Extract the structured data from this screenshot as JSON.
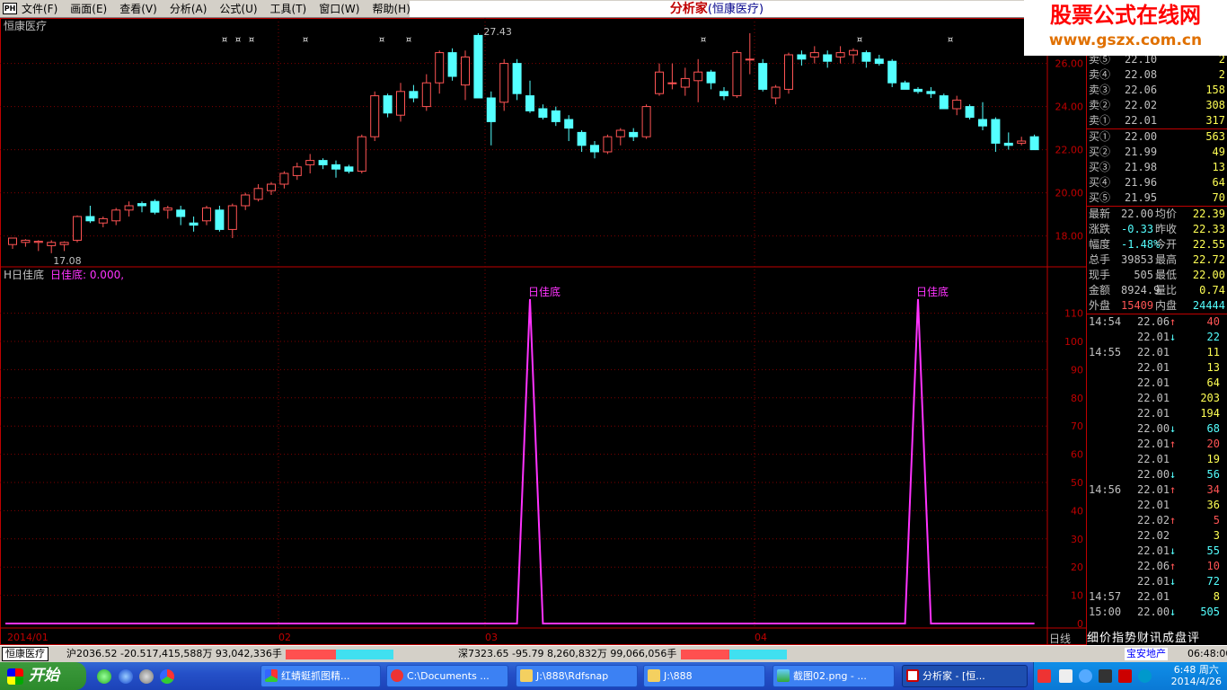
{
  "menubar": {
    "items": [
      "文件(F)",
      "画面(E)",
      "查看(V)",
      "分析(A)",
      "公式(U)",
      "工具(T)",
      "窗口(W)",
      "帮助(H)"
    ],
    "app_title": "分析家",
    "stock_title": "(恒康医疗)"
  },
  "watermark": {
    "line1": "股票公式在线网",
    "line2": "www.gszx.com.cn"
  },
  "main_chart": {
    "stock_name": "恒康医疗",
    "high_label": "27.43",
    "low_label": "17.08",
    "ylabels": [
      "26.00",
      "24.00",
      "22.00",
      "20.00",
      "18.00"
    ],
    "marker_glyph": "¤"
  },
  "indicator": {
    "name": "H日佳底",
    "value_text": "日佳底: 0.000,",
    "signal_label": "日佳底",
    "ylabels": [
      "110",
      "100",
      "90",
      "80",
      "70",
      "60",
      "50",
      "40",
      "30",
      "20",
      "10",
      "0"
    ]
  },
  "xaxis": {
    "labels": [
      "2014/01",
      "02",
      "03",
      "04"
    ],
    "right_label": "日线"
  },
  "order_book": {
    "sell": [
      {
        "label": "卖⑤",
        "price": "22.10",
        "vol": "2"
      },
      {
        "label": "卖④",
        "price": "22.08",
        "vol": "2"
      },
      {
        "label": "卖③",
        "price": "22.06",
        "vol": "158"
      },
      {
        "label": "卖②",
        "price": "22.02",
        "vol": "308"
      },
      {
        "label": "卖①",
        "price": "22.01",
        "vol": "317"
      }
    ],
    "buy": [
      {
        "label": "买①",
        "price": "22.00",
        "vol": "563"
      },
      {
        "label": "买②",
        "price": "21.99",
        "vol": "49"
      },
      {
        "label": "买③",
        "price": "21.98",
        "vol": "13"
      },
      {
        "label": "买④",
        "price": "21.96",
        "vol": "64"
      },
      {
        "label": "买⑤",
        "price": "21.95",
        "vol": "70"
      }
    ]
  },
  "stats": [
    {
      "l1": "最新",
      "v1": "22.00",
      "l2": "均价",
      "v2": "22.39"
    },
    {
      "l1": "涨跌",
      "v1": "-0.33",
      "l2": "昨收",
      "v2": "22.33"
    },
    {
      "l1": "幅度",
      "v1": "-1.48%",
      "l2": "今开",
      "v2": "22.55"
    },
    {
      "l1": "总手",
      "v1": "39853",
      "l2": "最高",
      "v2": "22.72"
    },
    {
      "l1": "现手",
      "v1": "505",
      "l2": "最低",
      "v2": "22.00"
    },
    {
      "l1": "金额",
      "v1": "8924.9",
      "l2": "量比",
      "v2": "0.74"
    },
    {
      "l1": "外盘",
      "v1": "15409",
      "l2": "内盘",
      "v2": "24444"
    }
  ],
  "ticks": [
    {
      "time": "14:54",
      "price": "22.06",
      "dir": "up",
      "vol": "40"
    },
    {
      "time": "",
      "price": "22.01",
      "dir": "down",
      "vol": "22"
    },
    {
      "time": "14:55",
      "price": "22.01",
      "dir": "",
      "vol": "11"
    },
    {
      "time": "",
      "price": "22.01",
      "dir": "",
      "vol": "13"
    },
    {
      "time": "",
      "price": "22.01",
      "dir": "",
      "vol": "64"
    },
    {
      "time": "",
      "price": "22.01",
      "dir": "",
      "vol": "203"
    },
    {
      "time": "",
      "price": "22.01",
      "dir": "",
      "vol": "194"
    },
    {
      "time": "",
      "price": "22.00",
      "dir": "down",
      "vol": "68"
    },
    {
      "time": "",
      "price": "22.01",
      "dir": "up",
      "vol": "20"
    },
    {
      "time": "",
      "price": "22.01",
      "dir": "",
      "vol": "19"
    },
    {
      "time": "",
      "price": "22.00",
      "dir": "down",
      "vol": "56"
    },
    {
      "time": "14:56",
      "price": "22.01",
      "dir": "up",
      "vol": "34"
    },
    {
      "time": "",
      "price": "22.01",
      "dir": "",
      "vol": "36"
    },
    {
      "time": "",
      "price": "22.02",
      "dir": "up",
      "vol": "5"
    },
    {
      "time": "",
      "price": "22.02",
      "dir": "",
      "vol": "3"
    },
    {
      "time": "",
      "price": "22.01",
      "dir": "down",
      "vol": "55"
    },
    {
      "time": "",
      "price": "22.06",
      "dir": "up",
      "vol": "10"
    },
    {
      "time": "",
      "price": "22.01",
      "dir": "down",
      "vol": "72"
    },
    {
      "time": "14:57",
      "price": "22.01",
      "dir": "",
      "vol": "8"
    },
    {
      "time": "15:00",
      "price": "22.00",
      "dir": "down",
      "vol": "505"
    }
  ],
  "bottom_tabs": "细价指势财讯成盘评",
  "statusbar": {
    "tab": "恒康医疗",
    "sh": "沪2036.52 -20.517,415,588万 93,042,336手",
    "sz": "深7323.65 -95.79 8,260,832万 99,066,056手",
    "stock_ticker": "宝安地产",
    "time": "06:48:00"
  },
  "taskbar": {
    "start": "开始",
    "tasks": [
      "红蜻蜓抓图精...",
      "C:\\Documents ...",
      "J:\\888\\Rdfsnap",
      "J:\\888",
      "截图02.png - ...",
      "分析家 - [恒..."
    ],
    "clock_time": "6:48 周六",
    "clock_date": "2014/4/26"
  },
  "chart_data": {
    "type": "candlestick",
    "ohlc": [
      [
        17.6,
        17.9,
        17.4,
        17.9
      ],
      [
        17.7,
        17.85,
        17.5,
        17.8
      ],
      [
        17.7,
        17.8,
        17.3,
        17.75
      ],
      [
        17.55,
        17.8,
        17.2,
        17.7
      ],
      [
        17.6,
        17.75,
        17.3,
        17.7
      ],
      [
        17.8,
        18.95,
        17.7,
        18.9
      ],
      [
        18.9,
        19.4,
        18.6,
        18.7
      ],
      [
        18.6,
        18.9,
        18.4,
        18.8
      ],
      [
        18.7,
        19.3,
        18.5,
        19.2
      ],
      [
        19.2,
        19.6,
        18.9,
        19.4
      ],
      [
        19.5,
        19.6,
        19.1,
        19.4
      ],
      [
        19.6,
        19.7,
        19.0,
        19.1
      ],
      [
        19.2,
        19.4,
        18.8,
        19.3
      ],
      [
        19.2,
        19.4,
        18.5,
        18.9
      ],
      [
        18.6,
        18.9,
        18.2,
        18.5
      ],
      [
        18.7,
        19.4,
        18.5,
        19.3
      ],
      [
        19.2,
        19.4,
        18.2,
        18.3
      ],
      [
        18.3,
        19.5,
        17.9,
        19.4
      ],
      [
        19.4,
        20.0,
        19.2,
        19.9
      ],
      [
        19.7,
        20.4,
        19.6,
        20.2
      ],
      [
        20.1,
        20.5,
        19.9,
        20.4
      ],
      [
        20.4,
        21.0,
        20.2,
        20.9
      ],
      [
        20.8,
        21.4,
        20.6,
        21.2
      ],
      [
        21.3,
        21.8,
        20.9,
        21.5
      ],
      [
        21.5,
        21.6,
        21.1,
        21.3
      ],
      [
        21.3,
        21.5,
        20.7,
        21.1
      ],
      [
        21.2,
        21.3,
        20.9,
        21.0
      ],
      [
        21.0,
        22.7,
        20.9,
        22.6
      ],
      [
        22.6,
        24.7,
        22.4,
        24.5
      ],
      [
        24.5,
        24.6,
        23.5,
        23.7
      ],
      [
        23.6,
        25.1,
        23.3,
        24.7
      ],
      [
        24.7,
        25.0,
        24.2,
        24.4
      ],
      [
        24.0,
        25.5,
        23.8,
        25.1
      ],
      [
        25.1,
        26.6,
        24.6,
        26.5
      ],
      [
        26.5,
        26.7,
        25.2,
        25.4
      ],
      [
        25.0,
        26.6,
        24.3,
        26.3
      ],
      [
        27.3,
        27.4,
        24.5,
        24.4
      ],
      [
        24.4,
        24.7,
        22.2,
        23.3
      ],
      [
        24.2,
        26.2,
        23.8,
        26.0
      ],
      [
        26.0,
        26.2,
        24.3,
        24.6
      ],
      [
        24.5,
        25.2,
        23.7,
        23.8
      ],
      [
        23.9,
        24.1,
        23.4,
        23.5
      ],
      [
        23.8,
        24.0,
        23.1,
        23.3
      ],
      [
        23.4,
        23.6,
        22.4,
        23.0
      ],
      [
        22.8,
        22.9,
        21.9,
        22.2
      ],
      [
        22.2,
        22.4,
        21.6,
        21.9
      ],
      [
        21.9,
        22.7,
        21.8,
        22.6
      ],
      [
        22.6,
        23.0,
        22.2,
        22.9
      ],
      [
        22.8,
        23.0,
        22.4,
        22.6
      ],
      [
        22.6,
        24.1,
        22.5,
        24.0
      ],
      [
        24.6,
        26.0,
        24.5,
        25.6
      ],
      [
        25.1,
        26.0,
        24.8,
        25.1
      ],
      [
        24.9,
        25.8,
        24.5,
        25.3
      ],
      [
        25.2,
        26.2,
        24.2,
        25.6
      ],
      [
        25.6,
        25.7,
        24.8,
        25.1
      ],
      [
        24.7,
        24.9,
        24.3,
        24.5
      ],
      [
        24.5,
        26.6,
        24.4,
        26.5
      ],
      [
        26.2,
        27.4,
        25.5,
        26.2
      ],
      [
        26.0,
        26.2,
        24.7,
        24.8
      ],
      [
        24.4,
        25.0,
        24.1,
        24.9
      ],
      [
        24.8,
        26.5,
        24.6,
        26.4
      ],
      [
        26.4,
        26.6,
        25.9,
        26.2
      ],
      [
        26.3,
        26.8,
        26.0,
        26.5
      ],
      [
        26.4,
        26.6,
        25.8,
        26.1
      ],
      [
        26.3,
        26.8,
        26.0,
        26.5
      ],
      [
        26.4,
        26.7,
        26.0,
        26.6
      ],
      [
        26.5,
        26.6,
        25.8,
        26.1
      ],
      [
        26.2,
        26.4,
        25.9,
        26.0
      ],
      [
        26.1,
        26.2,
        24.9,
        25.1
      ],
      [
        25.1,
        25.2,
        24.8,
        24.8
      ],
      [
        24.8,
        24.9,
        24.6,
        24.7
      ],
      [
        24.7,
        24.9,
        24.4,
        24.6
      ],
      [
        24.5,
        24.6,
        23.9,
        23.9
      ],
      [
        23.9,
        24.5,
        23.6,
        24.3
      ],
      [
        24.0,
        24.1,
        23.4,
        23.5
      ],
      [
        23.4,
        24.2,
        22.9,
        23.1
      ],
      [
        23.4,
        23.5,
        21.9,
        22.3
      ],
      [
        22.3,
        22.8,
        22.0,
        22.2
      ],
      [
        22.3,
        22.6,
        22.2,
        22.4
      ],
      [
        22.6,
        22.7,
        22.0,
        22.0
      ]
    ],
    "signal_days": [
      40,
      70
    ],
    "signal_peak": 115
  }
}
